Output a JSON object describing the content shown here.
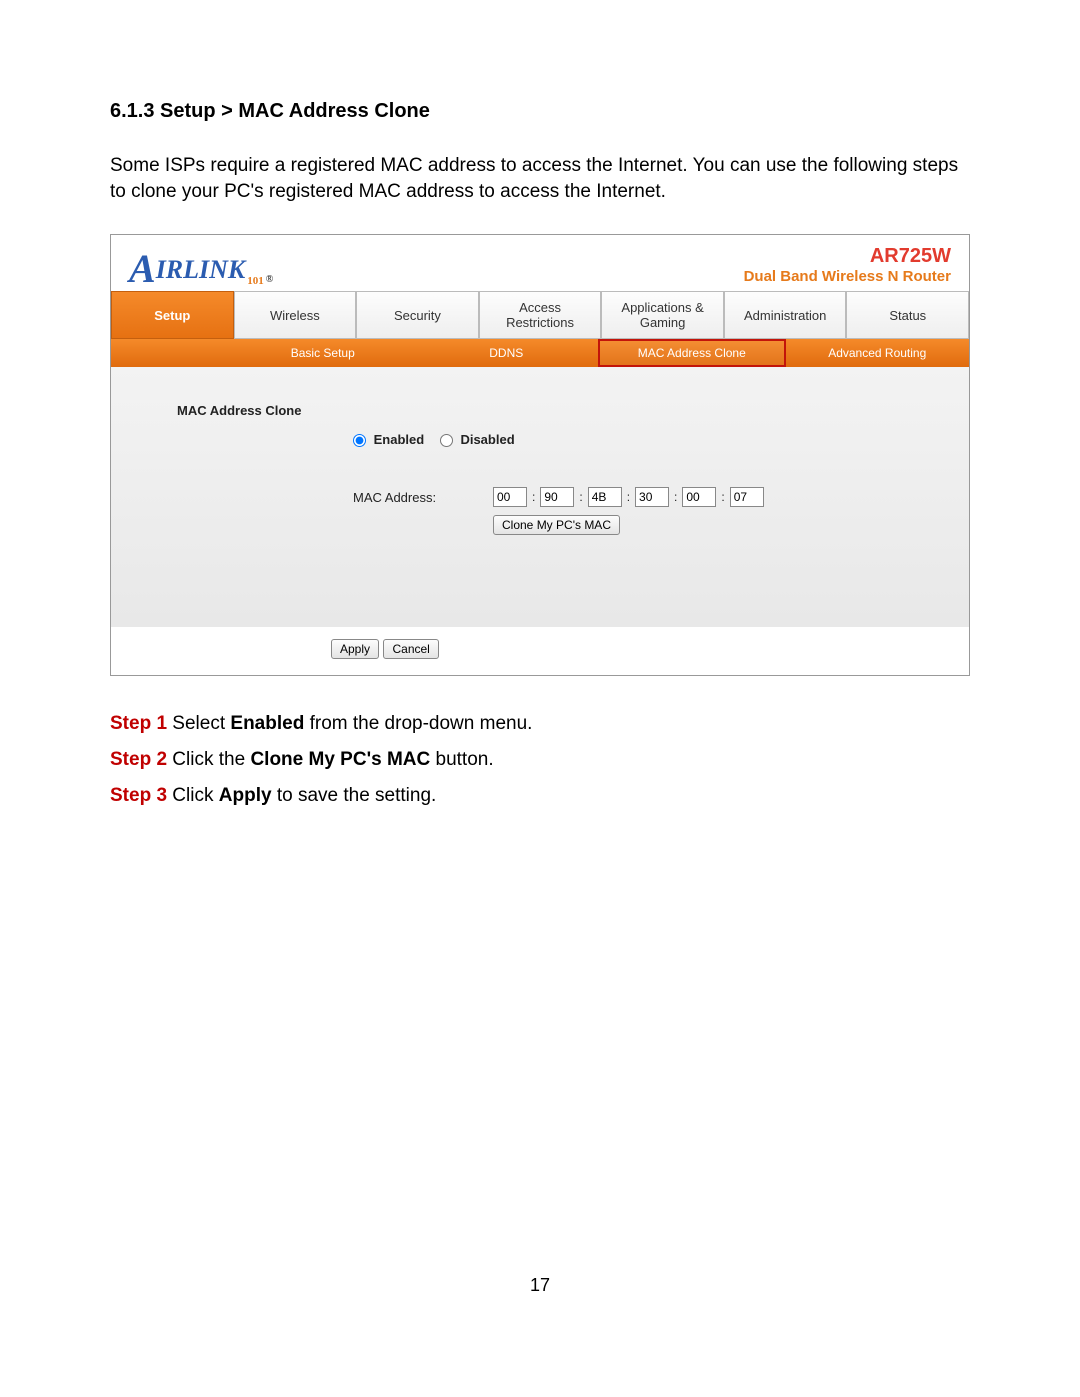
{
  "doc": {
    "section_title": "6.1.3 Setup > MAC Address Clone",
    "intro": "Some ISPs require a registered MAC address to access the Internet. You can use the following steps to clone your PC's registered MAC address to access the Internet.",
    "page_number": "17"
  },
  "router": {
    "brand_a": "A",
    "brand_rest": "IRLINK",
    "brand_sub": "101",
    "brand_reg": "®",
    "model": "AR725W",
    "tagline": "Dual Band Wireless N Router",
    "tabs": [
      "Setup",
      "Wireless",
      "Security",
      "Access Restrictions",
      "Applications & Gaming",
      "Administration",
      "Status"
    ],
    "active_tab_index": 0,
    "subtabs": [
      "Basic Setup",
      "DDNS",
      "MAC Address Clone",
      "Advanced Routing"
    ],
    "highlight_subtab_index": 2,
    "panel_title": "MAC Address Clone",
    "radio_enabled": "Enabled",
    "radio_disabled": "Disabled",
    "radio_selected": "enabled",
    "mac_label": "MAC Address:",
    "mac": [
      "00",
      "90",
      "4B",
      "30",
      "00",
      "07"
    ],
    "colon": ":",
    "clone_button": "Clone My PC's MAC",
    "apply": "Apply",
    "cancel": "Cancel"
  },
  "steps": {
    "s1": {
      "num": "Step 1",
      "a": " Select ",
      "b": "Enabled",
      "c": " from the drop-down menu."
    },
    "s2": {
      "num": "Step 2",
      "a": " Click the ",
      "b": "Clone My PC's MAC",
      "c": " button."
    },
    "s3": {
      "num": "Step 3",
      "a": " Click ",
      "b": "Apply",
      "c": " to save the setting."
    }
  }
}
